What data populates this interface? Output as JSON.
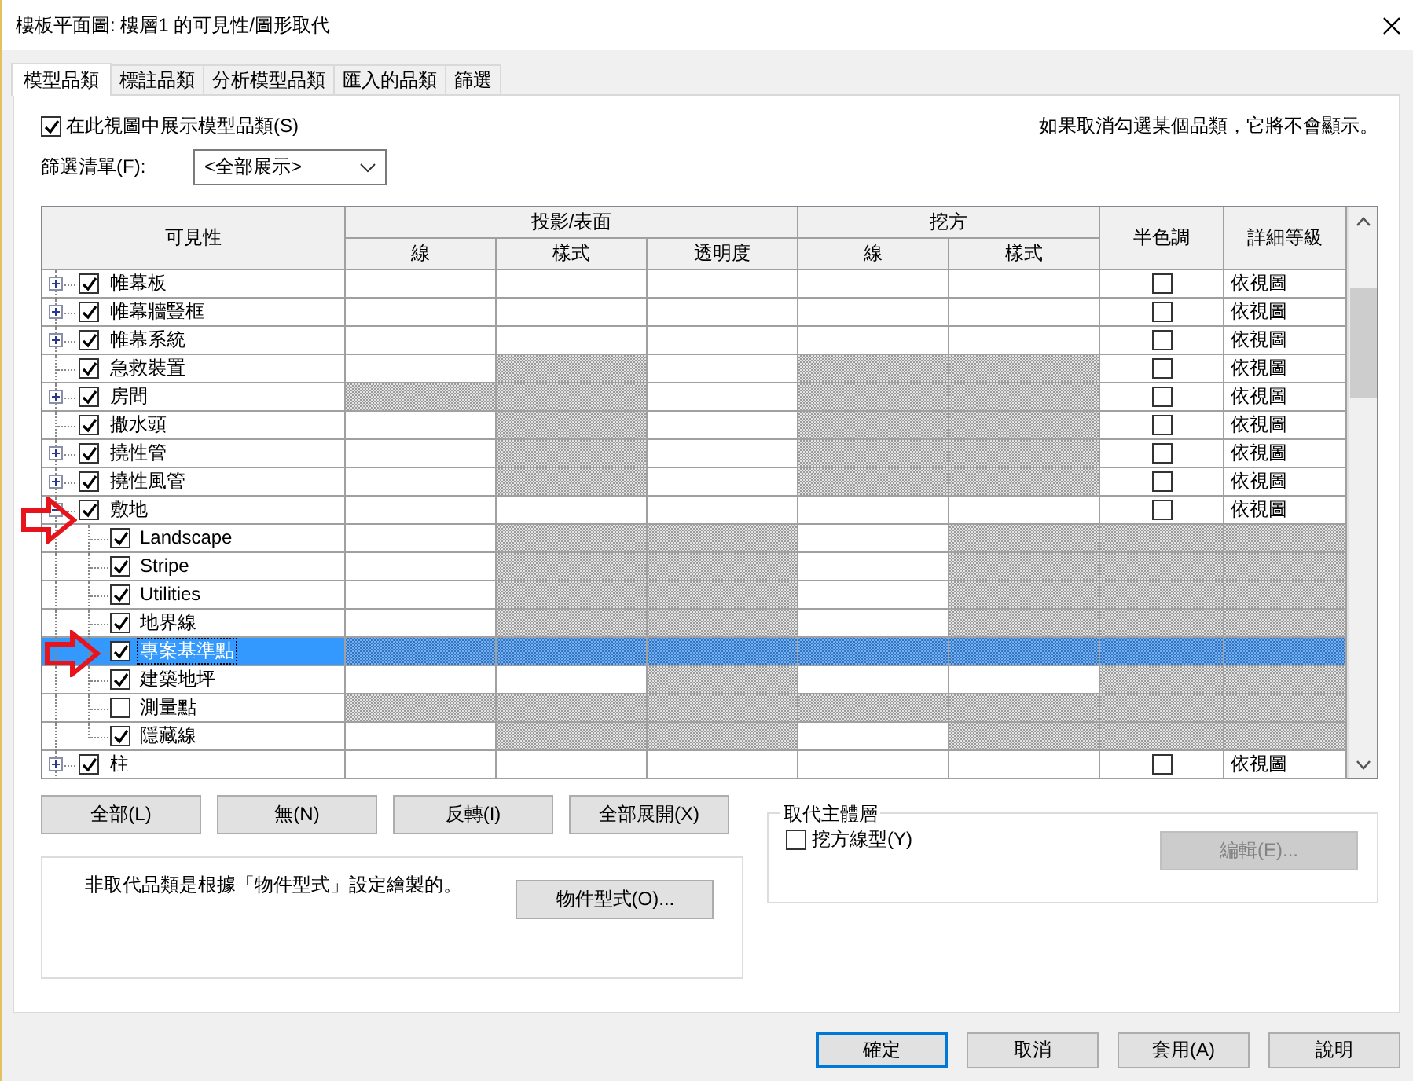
{
  "window": {
    "title": "樓板平面圖: 樓層1 的可見性/圖形取代"
  },
  "tabs": [
    {
      "label": "模型品類",
      "selected": true
    },
    {
      "label": "標註品類",
      "selected": false
    },
    {
      "label": "分析模型品類",
      "selected": false
    },
    {
      "label": "匯入的品類",
      "selected": false
    },
    {
      "label": "篩選",
      "selected": false
    }
  ],
  "show_categories": {
    "label": "在此視圖中展示模型品類(S)",
    "checked": true
  },
  "hint": "如果取消勾選某個品類，它將不會顯示。",
  "filter": {
    "label": "篩選清單(F):",
    "value": "<全部展示>"
  },
  "table": {
    "header": {
      "visibility": "可見性",
      "groups": [
        {
          "label": "投影/表面",
          "columns": [
            "線",
            "樣式",
            "透明度"
          ]
        },
        {
          "label": "挖方",
          "columns": [
            "線",
            "樣式"
          ]
        }
      ],
      "halftone": "半色調",
      "detail": "詳細等級"
    },
    "rows": [
      {
        "label": "帷幕板",
        "checked": true,
        "expanded": false,
        "selected": false,
        "cells": [
          {
            "disabled": false
          },
          {
            "disabled": false
          },
          {
            "disabled": false
          },
          {
            "disabled": false
          },
          {
            "disabled": false
          }
        ],
        "halftone": {
          "disabled": false,
          "checked": false
        },
        "detail": {
          "disabled": false,
          "text": "依視圖"
        }
      },
      {
        "label": "帷幕牆豎框",
        "checked": true,
        "expanded": false,
        "selected": false,
        "cells": [
          {
            "disabled": false
          },
          {
            "disabled": false
          },
          {
            "disabled": false
          },
          {
            "disabled": false
          },
          {
            "disabled": false
          }
        ],
        "halftone": {
          "disabled": false,
          "checked": false
        },
        "detail": {
          "disabled": false,
          "text": "依視圖"
        }
      },
      {
        "label": "帷幕系統",
        "checked": true,
        "expanded": false,
        "selected": false,
        "cells": [
          {
            "disabled": false
          },
          {
            "disabled": false
          },
          {
            "disabled": false
          },
          {
            "disabled": false
          },
          {
            "disabled": false
          }
        ],
        "halftone": {
          "disabled": false,
          "checked": false
        },
        "detail": {
          "disabled": false,
          "text": "依視圖"
        }
      },
      {
        "label": "急救裝置",
        "checked": true,
        "selected": false,
        "cells": [
          {
            "disabled": false
          },
          {
            "disabled": true
          },
          {
            "disabled": false
          },
          {
            "disabled": true
          },
          {
            "disabled": true
          }
        ],
        "halftone": {
          "disabled": false,
          "checked": false
        },
        "detail": {
          "disabled": false,
          "text": "依視圖"
        }
      },
      {
        "label": "房間",
        "checked": true,
        "expanded": false,
        "selected": false,
        "cells": [
          {
            "disabled": true
          },
          {
            "disabled": true
          },
          {
            "disabled": false
          },
          {
            "disabled": true
          },
          {
            "disabled": true
          }
        ],
        "halftone": {
          "disabled": false,
          "checked": false
        },
        "detail": {
          "disabled": false,
          "text": "依視圖"
        }
      },
      {
        "label": "撒水頭",
        "checked": true,
        "selected": false,
        "cells": [
          {
            "disabled": false
          },
          {
            "disabled": true
          },
          {
            "disabled": false
          },
          {
            "disabled": true
          },
          {
            "disabled": true
          }
        ],
        "halftone": {
          "disabled": false,
          "checked": false
        },
        "detail": {
          "disabled": false,
          "text": "依視圖"
        }
      },
      {
        "label": "撓性管",
        "checked": true,
        "expanded": false,
        "selected": false,
        "cells": [
          {
            "disabled": false
          },
          {
            "disabled": true
          },
          {
            "disabled": false
          },
          {
            "disabled": true
          },
          {
            "disabled": true
          }
        ],
        "halftone": {
          "disabled": false,
          "checked": false
        },
        "detail": {
          "disabled": false,
          "text": "依視圖"
        }
      },
      {
        "label": "撓性風管",
        "checked": true,
        "expanded": false,
        "selected": false,
        "cells": [
          {
            "disabled": false
          },
          {
            "disabled": true
          },
          {
            "disabled": false
          },
          {
            "disabled": true
          },
          {
            "disabled": true
          }
        ],
        "halftone": {
          "disabled": false,
          "checked": false
        },
        "detail": {
          "disabled": false,
          "text": "依視圖"
        }
      },
      {
        "label": "敷地",
        "checked": true,
        "expanded": true,
        "selected": false,
        "cells": [
          {
            "disabled": false
          },
          {
            "disabled": false
          },
          {
            "disabled": false
          },
          {
            "disabled": false
          },
          {
            "disabled": false
          }
        ],
        "halftone": {
          "disabled": false,
          "checked": false
        },
        "detail": {
          "disabled": false,
          "text": "依視圖"
        },
        "children": [
          {
            "label": "Landscape",
            "checked": true,
            "selected": false,
            "cells": [
              {
                "disabled": false
              },
              {
                "disabled": true
              },
              {
                "disabled": true
              },
              {
                "disabled": false
              },
              {
                "disabled": true
              }
            ],
            "halftone": {
              "disabled": true
            },
            "detail": {
              "disabled": true
            }
          },
          {
            "label": "Stripe",
            "checked": true,
            "selected": false,
            "cells": [
              {
                "disabled": false
              },
              {
                "disabled": true
              },
              {
                "disabled": true
              },
              {
                "disabled": false
              },
              {
                "disabled": true
              }
            ],
            "halftone": {
              "disabled": true
            },
            "detail": {
              "disabled": true
            }
          },
          {
            "label": "Utilities",
            "checked": true,
            "selected": false,
            "cells": [
              {
                "disabled": false
              },
              {
                "disabled": true
              },
              {
                "disabled": true
              },
              {
                "disabled": false
              },
              {
                "disabled": true
              }
            ],
            "halftone": {
              "disabled": true
            },
            "detail": {
              "disabled": true
            }
          },
          {
            "label": "地界線",
            "checked": true,
            "selected": false,
            "cells": [
              {
                "disabled": false
              },
              {
                "disabled": true
              },
              {
                "disabled": true
              },
              {
                "disabled": false
              },
              {
                "disabled": true
              }
            ],
            "halftone": {
              "disabled": true
            },
            "detail": {
              "disabled": true
            }
          },
          {
            "label": "專案基準點",
            "checked": true,
            "selected": true,
            "cells": [
              {
                "disabled": true
              },
              {
                "disabled": true
              },
              {
                "disabled": true
              },
              {
                "disabled": true
              },
              {
                "disabled": true
              }
            ],
            "halftone": {
              "disabled": true
            },
            "detail": {
              "disabled": true
            }
          },
          {
            "label": "建築地坪",
            "checked": true,
            "selected": false,
            "cells": [
              {
                "disabled": false
              },
              {
                "disabled": false
              },
              {
                "disabled": true
              },
              {
                "disabled": false
              },
              {
                "disabled": false
              }
            ],
            "halftone": {
              "disabled": true
            },
            "detail": {
              "disabled": true
            }
          },
          {
            "label": "測量點",
            "checked": false,
            "selected": false,
            "cells": [
              {
                "disabled": true
              },
              {
                "disabled": true
              },
              {
                "disabled": true
              },
              {
                "disabled": true
              },
              {
                "disabled": true
              }
            ],
            "halftone": {
              "disabled": true
            },
            "detail": {
              "disabled": true
            }
          },
          {
            "label": "隱藏線",
            "checked": true,
            "selected": false,
            "cells": [
              {
                "disabled": false
              },
              {
                "disabled": true
              },
              {
                "disabled": true
              },
              {
                "disabled": false
              },
              {
                "disabled": true
              }
            ],
            "halftone": {
              "disabled": true
            },
            "detail": {
              "disabled": true
            }
          }
        ]
      },
      {
        "label": "柱",
        "checked": true,
        "expanded": false,
        "selected": false,
        "cells": [
          {
            "disabled": false
          },
          {
            "disabled": false
          },
          {
            "disabled": false
          },
          {
            "disabled": false
          },
          {
            "disabled": false
          }
        ],
        "halftone": {
          "disabled": false,
          "checked": false
        },
        "detail": {
          "disabled": false,
          "text": "依視圖"
        }
      }
    ]
  },
  "row_buttons": [
    "全部(L)",
    "無(N)",
    "反轉(I)",
    "全部展開(X)"
  ],
  "note": {
    "text": "非取代品類是根據「物件型式」設定繪製的。",
    "button": "物件型式(O)..."
  },
  "override_host": {
    "title": "取代主體層",
    "checkbox": {
      "label": "挖方線型(Y)",
      "checked": false
    },
    "edit_button": {
      "label": "編輯(E)...",
      "disabled": true
    }
  },
  "footer_buttons": [
    {
      "label": "確定",
      "default": true
    },
    {
      "label": "取消",
      "default": false
    },
    {
      "label": "套用(A)",
      "default": false
    },
    {
      "label": "說明",
      "default": false
    }
  ]
}
